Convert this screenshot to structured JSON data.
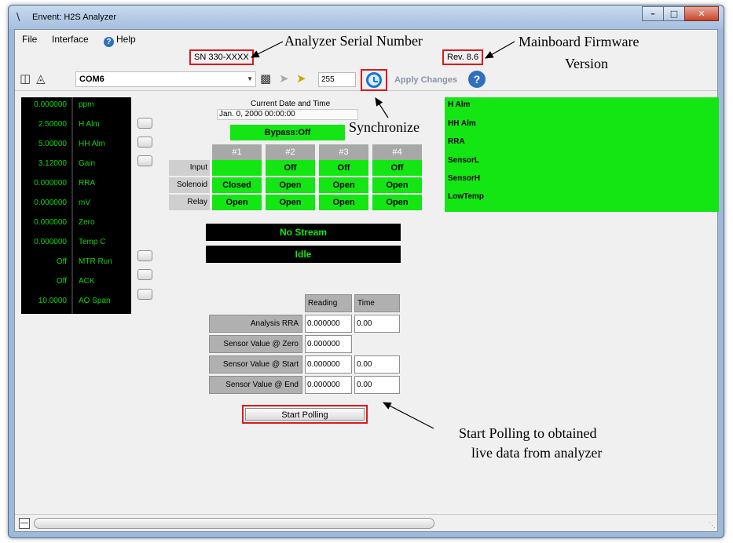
{
  "window": {
    "title": "Envent: H2S Analyzer",
    "minimize": "–",
    "maximize": "□",
    "close": "✕"
  },
  "menu": {
    "file": "File",
    "interface": "Interface",
    "help": "Help",
    "help_icon": "help-icon"
  },
  "info": {
    "serial": "SN 330-XXXX",
    "revision": "Rev. 8.6"
  },
  "toolbar": {
    "com_port": "COM6",
    "address": "255",
    "apply_label": "Apply Changes",
    "help_glyph": "?"
  },
  "readings": [
    {
      "value": "0.000000",
      "label": "ppm"
    },
    {
      "value": "2.50000",
      "label": "H Alm"
    },
    {
      "value": "5.00000",
      "label": "HH Alm"
    },
    {
      "value": "3.12000",
      "label": "Gain"
    },
    {
      "value": "0.000000",
      "label": "RRA"
    },
    {
      "value": "0.000000",
      "label": "mV"
    },
    {
      "value": "0.000000",
      "label": "Zero"
    },
    {
      "value": "0.000000",
      "label": "Temp C"
    },
    {
      "value": "Off",
      "label": "MTR Run"
    },
    {
      "value": "Off",
      "label": "ACK"
    },
    {
      "value": "10.0000",
      "label": "AO Span"
    }
  ],
  "datetime": {
    "label": "Current Date and Time",
    "value": "Jan. 0, 2000 00:00:00"
  },
  "bypass": "Bypass:Off",
  "streams": {
    "headers": [
      "#1",
      "#2",
      "#3",
      "#4"
    ],
    "row_labels": [
      "Input",
      "Solenoid",
      "Relay"
    ],
    "input": [
      "",
      "Off",
      "Off",
      "Off"
    ],
    "solenoid": [
      "Closed",
      "Open",
      "Open",
      "Open"
    ],
    "relay": [
      "Open",
      "Open",
      "Open",
      "Open"
    ]
  },
  "status": {
    "stream": "No Stream",
    "state": "Idle"
  },
  "analysis": {
    "col_reading": "Reading",
    "col_time": "Time",
    "rows": [
      {
        "label": "Analysis RRA",
        "reading": "0.000000",
        "time": "0.00"
      },
      {
        "label": "Sensor Value @ Zero",
        "reading": "0.000000",
        "time": ""
      },
      {
        "label": "Sensor Value @ Start",
        "reading": "0.000000",
        "time": "0.00"
      },
      {
        "label": "Sensor Value @ End",
        "reading": "0.000000",
        "time": "0.00"
      }
    ]
  },
  "start_polling": "Start Polling",
  "alarms": [
    "H Alm",
    "HH Alm",
    "RRA",
    "SensorL",
    "SensorH",
    "LowTemp"
  ],
  "annotations": {
    "serial": "Analyzer Serial Number",
    "firmware_line1": "Mainboard Firmware",
    "firmware_line2": "Version",
    "synchronize": "Synchronize",
    "polling_line1": "Start Polling to obtained",
    "polling_line2": "live data from analyzer"
  },
  "colors": {
    "alarm_green": "#14e614",
    "readout_green": "#12d612",
    "highlight_red": "#e01818"
  }
}
